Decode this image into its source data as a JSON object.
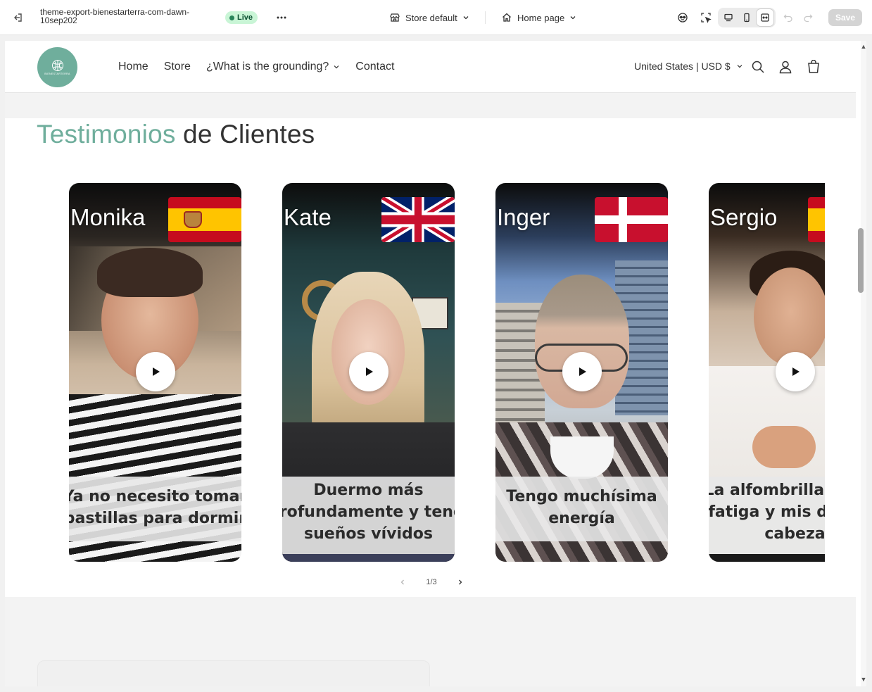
{
  "editor": {
    "theme_name": "theme-export-bienestarterra-com-dawn-10sep202",
    "status": "Live",
    "store_selector": "Store default",
    "page_selector": "Home page",
    "save_label": "Save",
    "icons": [
      "exit-icon",
      "more-icon",
      "store-icon",
      "home-icon",
      "ai-assistant-icon",
      "inspector-icon",
      "desktop-view-icon",
      "mobile-view-icon",
      "fullwidth-view-icon",
      "undo-icon",
      "redo-icon"
    ]
  },
  "store": {
    "logo_text": "BIENESTARTERRA",
    "nav": [
      "Home",
      "Store",
      "¿What is the grounding?",
      "Contact"
    ],
    "locale": "United States | USD $",
    "header_icons": [
      "search-icon",
      "account-icon",
      "cart-icon"
    ]
  },
  "section": {
    "title_accent": "Testimonios",
    "title_rest": " de Clientes",
    "pager": "1/3"
  },
  "testimonials": [
    {
      "name": "Monika",
      "flag": "spain",
      "caption_1": "Ya no necesito tomar",
      "caption_2": "pastillas para dormir",
      "caption_3": ""
    },
    {
      "name": "Kate",
      "flag": "united-kingdom",
      "caption_1": "Duermo más",
      "caption_2": "profundamente y tengo",
      "caption_3": "sueños vívidos"
    },
    {
      "name": "Inger",
      "flag": "denmark",
      "caption_1": "Tengo muchísima",
      "caption_2": "energía",
      "caption_3": ""
    },
    {
      "name": "Sergio",
      "flag": "spain",
      "caption_1": "La alfombrilla redujo",
      "caption_2": "fatiga y mis dolores",
      "caption_3": "cabeza"
    }
  ],
  "colors": {
    "accent": "#6fae9c",
    "live_bg": "#c9f5d6",
    "live_text": "#0c5132"
  }
}
